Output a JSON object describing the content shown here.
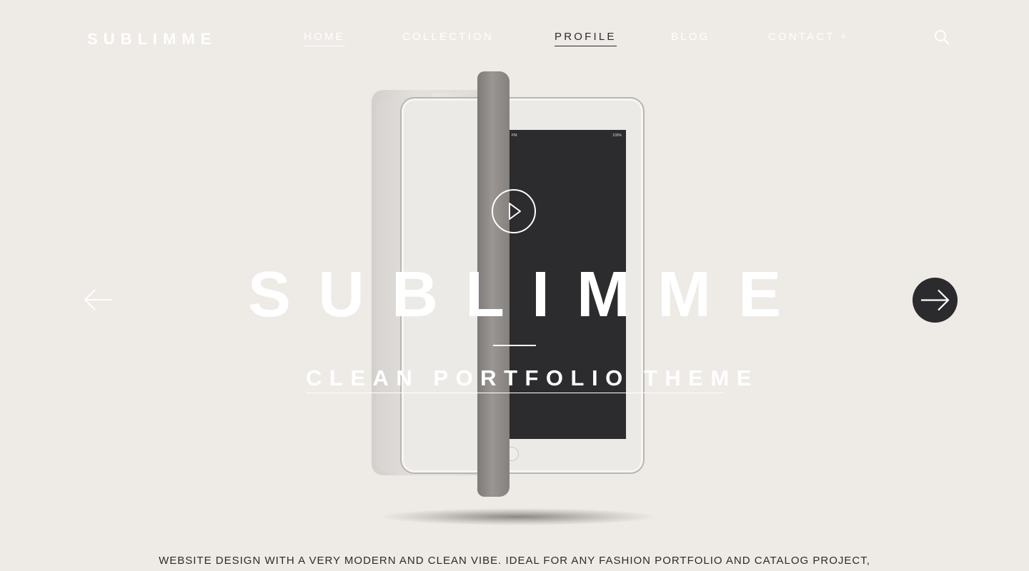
{
  "brand": {
    "logo": "SUBLIMME"
  },
  "nav": {
    "items": [
      {
        "label": "HOME"
      },
      {
        "label": "COLLECTION"
      },
      {
        "label": "PROFILE"
      },
      {
        "label": "BLOG"
      },
      {
        "label": "CONTACT +"
      }
    ],
    "active": "PROFILE",
    "search_icon": "search-icon"
  },
  "hero": {
    "title": "SUBLIMME",
    "subtitle": "CLEAN PORTFOLIO THEME",
    "play_icon": "play-icon",
    "prev_icon": "arrow-left-icon",
    "next_icon": "arrow-right-icon",
    "screen_status": "100%",
    "screen_time": "PM"
  },
  "description": "WEBSITE DESIGN WITH A VERY MODERN AND CLEAN VIBE. IDEAL FOR ANY FASHION PORTFOLIO AND CATALOG PROJECT,",
  "colors": {
    "background": "#eeeae6",
    "text_light": "#ffffff",
    "text_dark": "#2b2b2d",
    "accent_dark": "#2b2b2d"
  }
}
